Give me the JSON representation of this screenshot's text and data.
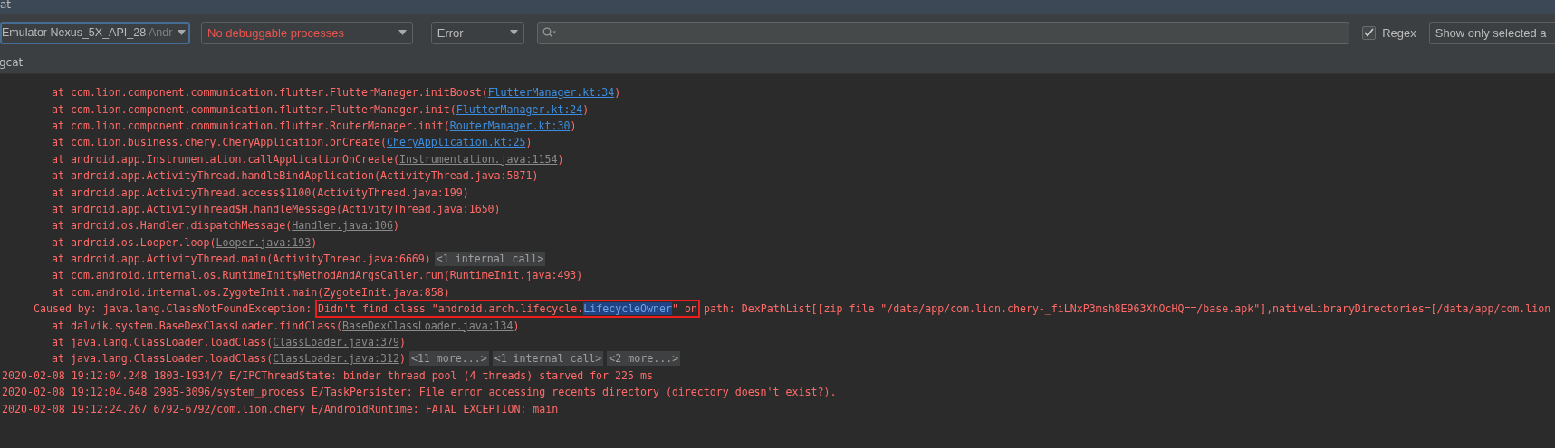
{
  "window": {
    "title": "at"
  },
  "toolbar": {
    "device": {
      "name": "Emulator Nexus_5X_API_28",
      "detail": "Andr"
    },
    "process": {
      "value": "No debuggable processes"
    },
    "level": {
      "value": "Error"
    },
    "regex": {
      "label": "Regex",
      "checked": true
    },
    "filter": {
      "value": "Show only selected a"
    }
  },
  "panel": {
    "title": "gcat"
  },
  "log": [
    {
      "kind": "frame",
      "segments": [
        {
          "kind": "text",
          "text": "at com.lion.component.communication.flutter.FlutterManager.initBoost("
        },
        {
          "kind": "link",
          "text": "FlutterManager.kt:34"
        },
        {
          "kind": "text",
          "text": ")"
        }
      ]
    },
    {
      "kind": "frame",
      "segments": [
        {
          "kind": "text",
          "text": "at com.lion.component.communication.flutter.FlutterManager.init("
        },
        {
          "kind": "link",
          "text": "FlutterManager.kt:24"
        },
        {
          "kind": "text",
          "text": ")"
        }
      ]
    },
    {
      "kind": "frame",
      "segments": [
        {
          "kind": "text",
          "text": "at com.lion.component.communication.flutter.RouterManager.init("
        },
        {
          "kind": "link",
          "text": "RouterManager.kt:30"
        },
        {
          "kind": "text",
          "text": ")"
        }
      ]
    },
    {
      "kind": "frame",
      "segments": [
        {
          "kind": "text",
          "text": "at com.lion.business.chery.CheryApplication.onCreate("
        },
        {
          "kind": "link",
          "text": "CheryApplication.kt:25"
        },
        {
          "kind": "text",
          "text": ")"
        }
      ]
    },
    {
      "kind": "frame",
      "segments": [
        {
          "kind": "text",
          "text": "at android.app.Instrumentation.callApplicationOnCreate("
        },
        {
          "kind": "ref",
          "text": "Instrumentation.java:1154"
        },
        {
          "kind": "text",
          "text": ")"
        }
      ]
    },
    {
      "kind": "frame",
      "segments": [
        {
          "kind": "text",
          "text": "at android.app.ActivityThread.handleBindApplication(ActivityThread.java:5871)"
        }
      ]
    },
    {
      "kind": "frame",
      "segments": [
        {
          "kind": "text",
          "text": "at android.app.ActivityThread.access$1100(ActivityThread.java:199)"
        }
      ]
    },
    {
      "kind": "frame",
      "segments": [
        {
          "kind": "text",
          "text": "at android.app.ActivityThread$H.handleMessage(ActivityThread.java:1650)"
        }
      ]
    },
    {
      "kind": "frame",
      "segments": [
        {
          "kind": "text",
          "text": "at android.os.Handler.dispatchMessage("
        },
        {
          "kind": "ref",
          "text": "Handler.java:106"
        },
        {
          "kind": "text",
          "text": ")"
        }
      ]
    },
    {
      "kind": "frame",
      "segments": [
        {
          "kind": "text",
          "text": "at android.os.Looper.loop("
        },
        {
          "kind": "ref",
          "text": "Looper.java:193"
        },
        {
          "kind": "text",
          "text": ")"
        }
      ]
    },
    {
      "kind": "frame",
      "segments": [
        {
          "kind": "text",
          "text": "at android.app.ActivityThread.main(ActivityThread.java:6669)"
        },
        {
          "kind": "fold",
          "text": "<1 internal call>"
        }
      ]
    },
    {
      "kind": "frame",
      "segments": [
        {
          "kind": "text",
          "text": "at com.android.internal.os.RuntimeInit$MethodAndArgsCaller.run(RuntimeInit.java:493)"
        }
      ]
    },
    {
      "kind": "frame",
      "segments": [
        {
          "kind": "text",
          "text": "at com.android.internal.os.ZygoteInit.main(ZygoteInit.java:858)"
        }
      ]
    },
    {
      "kind": "cause",
      "segments": [
        {
          "kind": "text",
          "text": "Caused by: java.lang.ClassNotFoundException: "
        },
        {
          "kind": "boxed",
          "parts": [
            {
              "kind": "text",
              "text": "Didn't find class \"android.arch.lifecycle."
            },
            {
              "kind": "selected",
              "text": "LifecycleOwner"
            },
            {
              "kind": "text",
              "text": "\" on"
            }
          ]
        },
        {
          "kind": "text",
          "text": " path: DexPathList[[zip file \"/data/app/com.lion.chery-_fiLNxP3msh8E963XhOcHQ==/base.apk\"],nativeLibraryDirectories=[/data/app/com.lion"
        }
      ]
    },
    {
      "kind": "frame",
      "segments": [
        {
          "kind": "text",
          "text": "at dalvik.system.BaseDexClassLoader.findClass("
        },
        {
          "kind": "ref",
          "text": "BaseDexClassLoader.java:134"
        },
        {
          "kind": "text",
          "text": ")"
        }
      ]
    },
    {
      "kind": "frame",
      "segments": [
        {
          "kind": "text",
          "text": "at java.lang.ClassLoader.loadClass("
        },
        {
          "kind": "ref",
          "text": "ClassLoader.java:379"
        },
        {
          "kind": "text",
          "text": ")"
        }
      ]
    },
    {
      "kind": "frame",
      "segments": [
        {
          "kind": "text",
          "text": "at java.lang.ClassLoader.loadClass("
        },
        {
          "kind": "ref",
          "text": "ClassLoader.java:312"
        },
        {
          "kind": "text",
          "text": ")"
        },
        {
          "kind": "fold",
          "text": "<11 more...>"
        },
        {
          "kind": "fold",
          "text": "<1 internal call>"
        },
        {
          "kind": "fold",
          "text": "<2 more...>"
        }
      ]
    },
    {
      "kind": "entry",
      "segments": [
        {
          "kind": "text",
          "text": "2020-02-08 19:12:04.248 1803-1934/? E/IPCThreadState: binder thread pool (4 threads) starved for 225 ms"
        }
      ]
    },
    {
      "kind": "entry",
      "segments": [
        {
          "kind": "text",
          "text": "2020-02-08 19:12:04.648 2985-3096/system_process E/TaskPersister: File error accessing recents directory (directory doesn't exist?)."
        }
      ]
    },
    {
      "kind": "entry",
      "segments": [
        {
          "kind": "text",
          "text": "2020-02-08 19:12:24.267 6792-6792/com.lion.chery E/AndroidRuntime: FATAL EXCEPTION: main"
        }
      ]
    }
  ]
}
